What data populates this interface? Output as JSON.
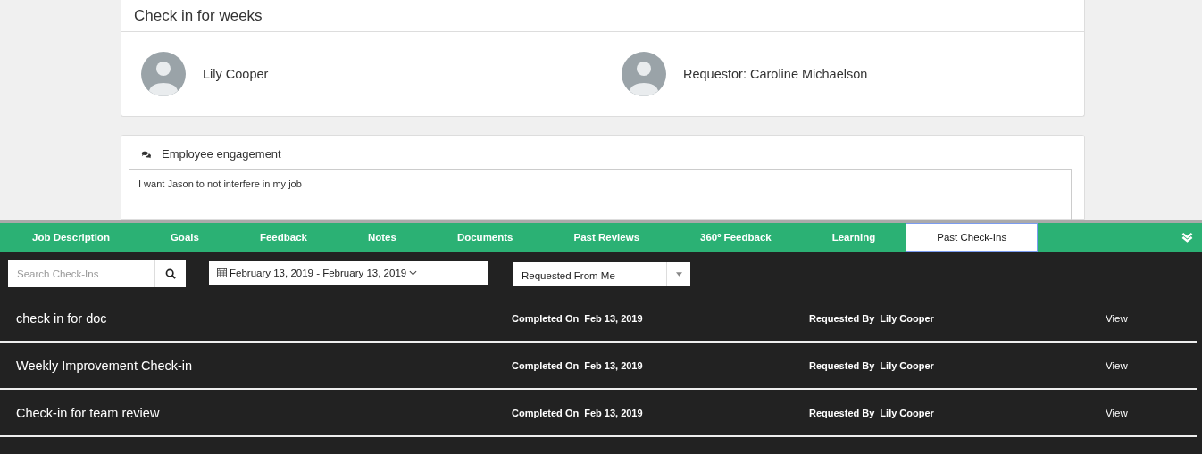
{
  "page_title": "Check in for weeks",
  "people": [
    {
      "name": "Lily Cooper"
    },
    {
      "name": "Requestor: Caroline Michaelson"
    }
  ],
  "question": {
    "title": "Employee engagement",
    "answer": "I want Jason to not interfere in my job"
  },
  "tabs": [
    {
      "label": "Job Description",
      "selected": false
    },
    {
      "label": "Goals",
      "selected": false
    },
    {
      "label": "Feedback",
      "selected": false
    },
    {
      "label": "Notes",
      "selected": false
    },
    {
      "label": "Documents",
      "selected": false
    },
    {
      "label": "Past Reviews",
      "selected": false
    },
    {
      "label": "360º Feedback",
      "selected": false
    },
    {
      "label": "Learning",
      "selected": false
    },
    {
      "label": "Past Check-Ins",
      "selected": true
    }
  ],
  "toolbar": {
    "search": {
      "placeholder": "Search Check-Ins"
    },
    "date_range": "February 13, 2019 - February 13, 2019",
    "filter": "Requested From Me"
  },
  "checkins": [
    {
      "title": "check in for doc",
      "completed_label": "Completed On",
      "completed_date": "Feb 13, 2019",
      "requested_label": "Requested By",
      "requested_by": "Lily Cooper",
      "action": "View"
    },
    {
      "title": "Weekly Improvement Check-in",
      "completed_label": "Completed On",
      "completed_date": "Feb 13, 2019",
      "requested_label": "Requested By",
      "requested_by": "Lily Cooper",
      "action": "View"
    },
    {
      "title": "Check-in for team review",
      "completed_label": "Completed On",
      "completed_date": "Feb 13, 2019",
      "requested_label": "Requested By",
      "requested_by": "Lily Cooper",
      "action": "View"
    }
  ]
}
